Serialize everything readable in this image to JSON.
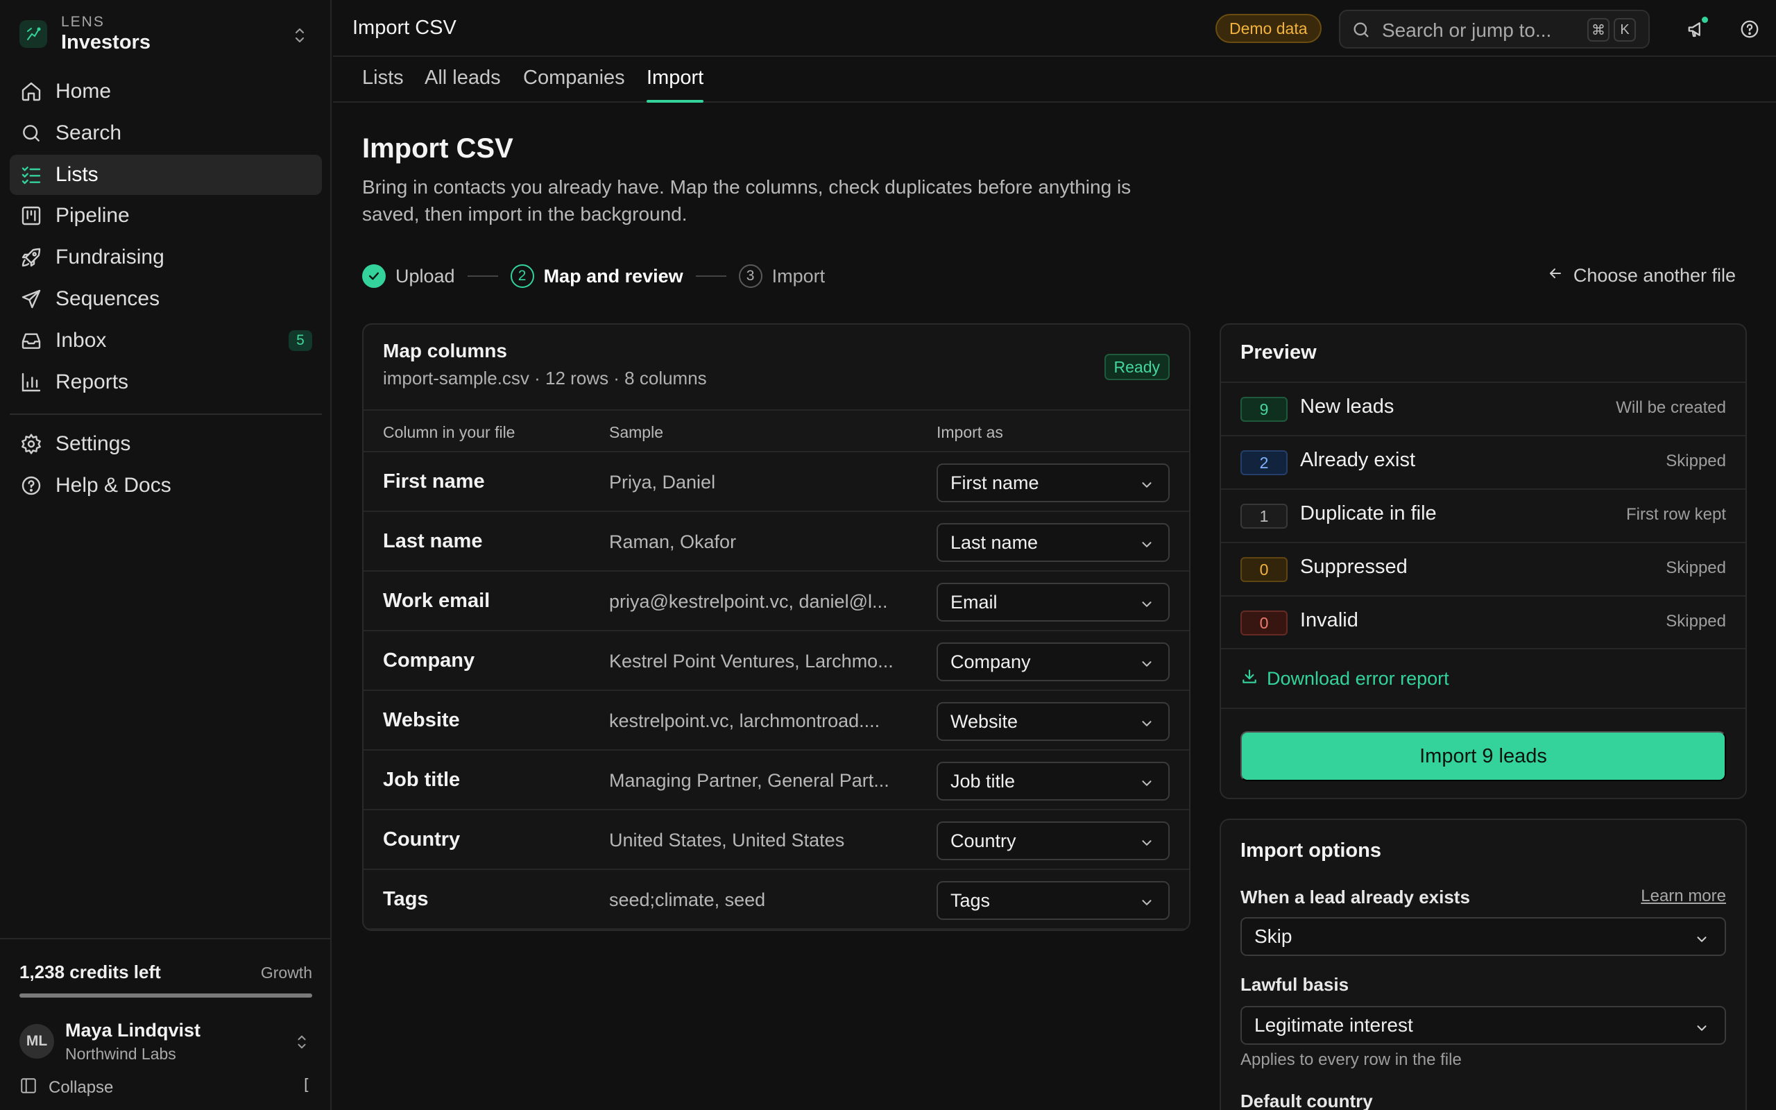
{
  "brand": {
    "small": "LENS",
    "name": "Investors"
  },
  "nav": {
    "items": [
      {
        "label": "Home"
      },
      {
        "label": "Search"
      },
      {
        "label": "Lists"
      },
      {
        "label": "Pipeline"
      },
      {
        "label": "Fundraising"
      },
      {
        "label": "Sequences"
      },
      {
        "label": "Inbox",
        "badge": "5"
      },
      {
        "label": "Reports"
      }
    ],
    "secondary": [
      {
        "label": "Settings"
      },
      {
        "label": "Help & Docs"
      }
    ]
  },
  "footer": {
    "credits": "1,238 credits left",
    "plan": "Growth",
    "credits_fraction": 1.0,
    "user_initials": "ML",
    "user_name": "Maya Lindqvist",
    "user_org": "Northwind Labs",
    "collapse_label": "Collapse",
    "collapse_key": "["
  },
  "topbar": {
    "title": "Import CSV",
    "demo_badge": "Demo data",
    "search_placeholder": "Search or jump to...",
    "kbd_cmd": "⌘",
    "kbd_k": "K"
  },
  "tabs": [
    {
      "label": "Lists"
    },
    {
      "label": "All leads"
    },
    {
      "label": "Companies"
    },
    {
      "label": "Import",
      "active": true
    }
  ],
  "page": {
    "title": "Import CSV",
    "description": "Bring in contacts you already have. Map the columns, check duplicates before anything is saved, then import in the background."
  },
  "stepper": {
    "steps": [
      {
        "number": "",
        "label": "Upload",
        "state": "done"
      },
      {
        "number": "2",
        "label": "Map and review",
        "state": "current"
      },
      {
        "number": "3",
        "label": "Import",
        "state": "future"
      }
    ],
    "choose_another": "Choose another file"
  },
  "map": {
    "title": "Map columns",
    "subtitle": "import-sample.csv · 12 rows · 8 columns",
    "badge": "Ready",
    "headers": {
      "column": "Column in your file",
      "sample": "Sample",
      "import_as": "Import as"
    },
    "rows": [
      {
        "column": "First name",
        "sample": "Priya, Daniel",
        "import_as": "First name"
      },
      {
        "column": "Last name",
        "sample": "Raman, Okafor",
        "import_as": "Last name"
      },
      {
        "column": "Work email",
        "sample": "priya@kestrelpoint.vc, daniel@l...",
        "import_as": "Email"
      },
      {
        "column": "Company",
        "sample": "Kestrel Point Ventures, Larchmo...",
        "import_as": "Company"
      },
      {
        "column": "Website",
        "sample": "kestrelpoint.vc, larchmontroad....",
        "import_as": "Website"
      },
      {
        "column": "Job title",
        "sample": "Managing Partner, General Part...",
        "import_as": "Job title"
      },
      {
        "column": "Country",
        "sample": "United States, United States",
        "import_as": "Country"
      },
      {
        "column": "Tags",
        "sample": "seed;climate, seed",
        "import_as": "Tags"
      }
    ]
  },
  "preview": {
    "title": "Preview",
    "rows": [
      {
        "count": "9",
        "label": "New leads",
        "status": "Will be created",
        "tone": "green"
      },
      {
        "count": "2",
        "label": "Already exist",
        "status": "Skipped",
        "tone": "blue"
      },
      {
        "count": "1",
        "label": "Duplicate in file",
        "status": "First row kept",
        "tone": "gray"
      },
      {
        "count": "0",
        "label": "Suppressed",
        "status": "Skipped",
        "tone": "amber"
      },
      {
        "count": "0",
        "label": "Invalid",
        "status": "Skipped",
        "tone": "red"
      }
    ],
    "download": "Download error report",
    "import_button": "Import 9 leads"
  },
  "options": {
    "title": "Import options",
    "exists_label": "When a lead already exists",
    "learn_more": "Learn more",
    "exists_value": "Skip",
    "lawful_label": "Lawful basis",
    "lawful_value": "Legitimate interest",
    "lawful_hint": "Applies to every row in the file",
    "country_label": "Default country"
  },
  "colors": {
    "accent": "#33d39b",
    "tone_green": "#43d69d",
    "tone_blue": "#7fb2ff",
    "tone_gray": "#bdbdbd",
    "tone_amber": "#f4b33c",
    "tone_red": "#f07a6c"
  },
  "icons": {
    "nav": [
      "home-icon",
      "search-icon",
      "list-checks-icon",
      "kanban-icon",
      "rocket-icon",
      "send-icon",
      "inbox-icon",
      "bar-chart-icon"
    ],
    "secondary": [
      "gear-icon",
      "help-circle-icon"
    ]
  }
}
